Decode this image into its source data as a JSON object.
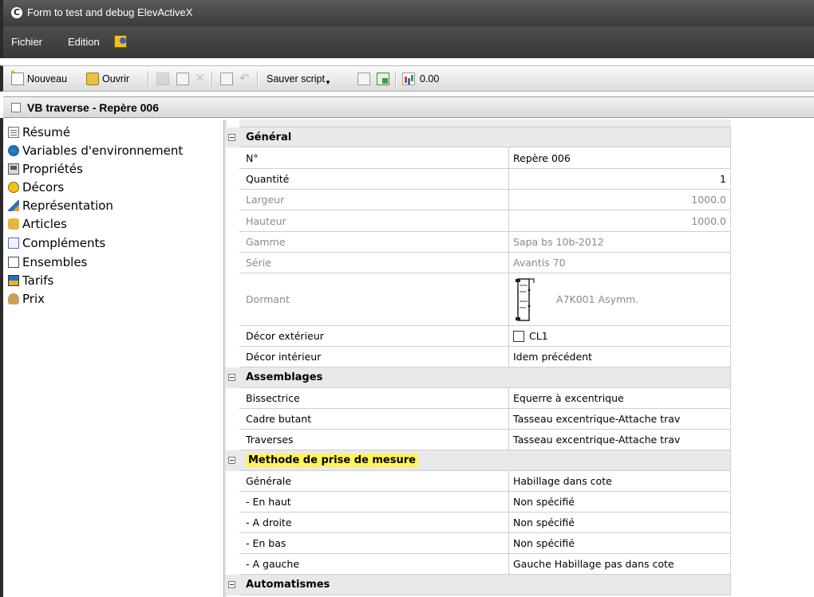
{
  "window": {
    "title": "Form to test and debug ElevActiveX"
  },
  "menu": {
    "items": [
      "Fichier",
      "Edition"
    ]
  },
  "toolbar": {
    "new_label": "Nouveau",
    "open_label": "Ouvrir",
    "save_script_label": "Sauver script",
    "counter": "0.00"
  },
  "document": {
    "title": "VB traverse - Repère 006"
  },
  "sidebar": {
    "items": [
      {
        "label": "Résumé",
        "icon": "summary-icon"
      },
      {
        "label": "Variables d'environnement",
        "icon": "environment-icon"
      },
      {
        "label": "Propriétés",
        "icon": "properties-icon"
      },
      {
        "label": "Décors",
        "icon": "decor-icon"
      },
      {
        "label": "Représentation",
        "icon": "representation-icon"
      },
      {
        "label": "Articles",
        "icon": "articles-icon"
      },
      {
        "label": "Compléments",
        "icon": "complements-icon"
      },
      {
        "label": "Ensembles",
        "icon": "ensembles-icon"
      },
      {
        "label": "Tarifs",
        "icon": "tarifs-icon"
      },
      {
        "label": "Prix",
        "icon": "prix-icon"
      }
    ]
  },
  "grid": {
    "general": {
      "title": "Général",
      "rows": [
        {
          "name": "N°",
          "value": "Repère 006"
        },
        {
          "name": "Quantité",
          "value": "1"
        },
        {
          "name": "Largeur",
          "value": "1000.0"
        },
        {
          "name": "Hauteur",
          "value": "1000.0"
        },
        {
          "name": "Gamme",
          "value": "Sapa bs 10b-2012"
        },
        {
          "name": "Série",
          "value": "Avantis 70"
        },
        {
          "name": "Dormant",
          "value": "A7K001 Asymm."
        },
        {
          "name": "Décor extérieur",
          "value": "CL1"
        },
        {
          "name": "Décor intérieur",
          "value": "Idem précédent"
        }
      ]
    },
    "assemblages": {
      "title": "Assemblages",
      "rows": [
        {
          "name": "Bissectrice",
          "value": "Equerre à excentrique"
        },
        {
          "name": "Cadre butant",
          "value": "Tasseau excentrique-Attache trav"
        },
        {
          "name": "Traverses",
          "value": "Tasseau excentrique-Attache trav"
        }
      ]
    },
    "mesure": {
      "title": "Methode de prise de mesure",
      "rows": [
        {
          "name": "Générale",
          "value": "Habillage dans cote"
        },
        {
          "name": "- En haut",
          "value": "Non spécifié"
        },
        {
          "name": "- A droite",
          "value": "Non spécifié"
        },
        {
          "name": "- En bas",
          "value": "Non spécifié"
        },
        {
          "name": "- A gauche",
          "value": "Gauche Habillage pas dans cote"
        }
      ]
    },
    "automatismes": {
      "title": "Automatismes"
    }
  },
  "colors": {
    "title_bar": "#4a4a4a",
    "highlight": "#fff35a",
    "category_bg": "#e9e9e9"
  }
}
